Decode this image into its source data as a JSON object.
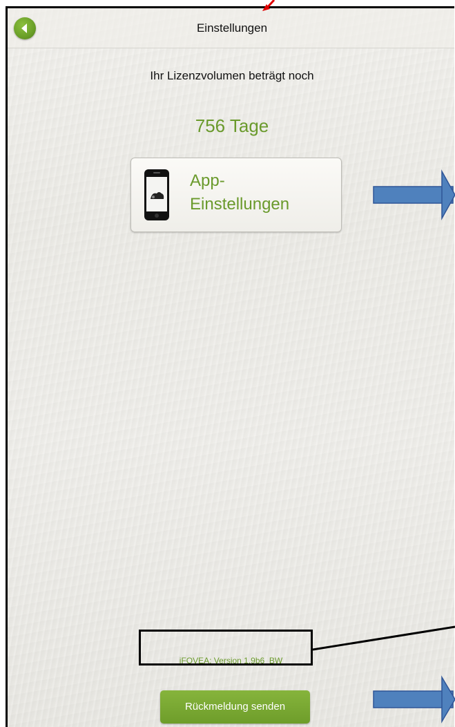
{
  "navbar": {
    "title": "Einstellungen",
    "back_icon": "chevron-left-icon"
  },
  "license": {
    "label": "Ihr Lizenzvolumen beträgt noch",
    "days": "756 Tage"
  },
  "app_settings": {
    "label_line1": "App-",
    "label_line2": "Einstellungen",
    "icon": "smartphone-icon"
  },
  "footer": {
    "version": "iFOVEA: Version 1.9b6_BW",
    "feedback_label": "Rückmeldung senden"
  },
  "colors": {
    "accent_green": "#6a9a2c",
    "annotation_blue": "#4f81bd",
    "annotation_red": "#e00000"
  }
}
